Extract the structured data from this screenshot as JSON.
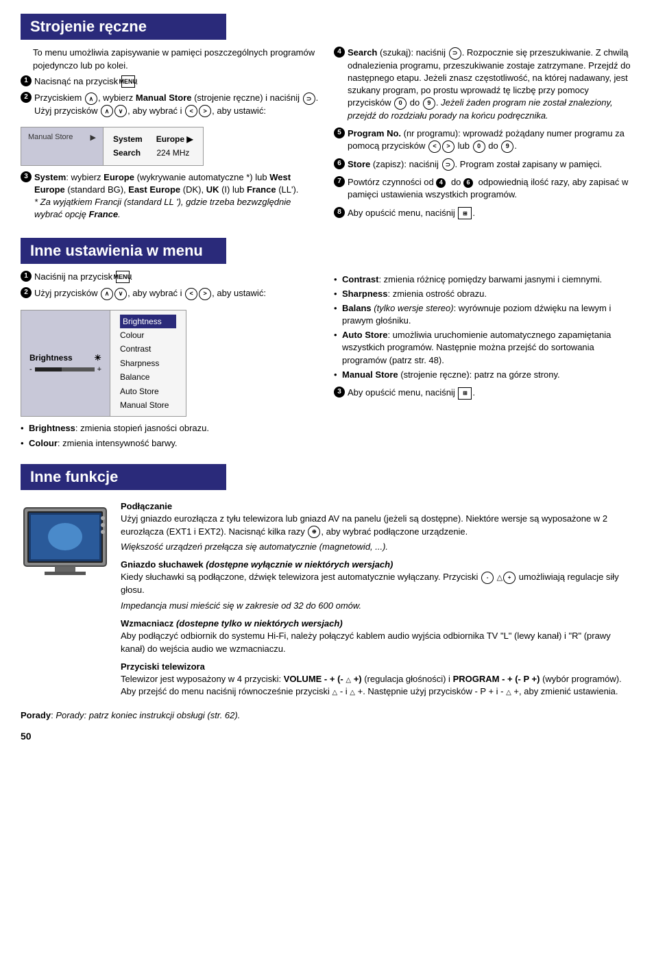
{
  "sections": {
    "strojenie": {
      "title": "Strojenie ręczne",
      "intro": "To menu umożliwia zapisywanie w pamięci poszczególnych programów pojedynczo lub po kolei.",
      "steps": [
        {
          "num": "1",
          "text": "Nacisnąć na przycisk"
        },
        {
          "num": "2",
          "text": "Przyciskiem , wybierz Manual Store (strojenie ręczne) i naciśnij . Użyj przycisków , aby wybrać i , aby ustawić:"
        },
        {
          "num": "3",
          "text": "System: wybierz Europe (wykrywanie automatyczne *) lub West Europe (standard BG), East Europe (DK), UK (I) lub France (LL').",
          "italic_note": "* Za wyjątkiem Francji (standard LL '), gdzie trzeba bezwzględnie wybrać opcję France."
        }
      ],
      "menu_left_title": "Manual Store",
      "menu_rows": [
        {
          "label": "System",
          "value": "Europe ▶"
        },
        {
          "label": "Search",
          "value": "224 MHz"
        }
      ],
      "right_steps": [
        {
          "num": "4",
          "bold_label": "Search",
          "bold_paren": "(szukaj)",
          "text": ": naciśnij . Rozpocznie się przeszukiwanie. Z chwilą odnalezienia programu, przeszukiwanie zostaje zatrzymane. Przejdź do następnego etapu. Jeżeli znasz częstotliwość, na której nadawany, jest szukany program, po prostu wprowadź tę liczbę przy pomocy przycisków",
          "end_text": ". Jeżeli żaden program nie został znaleziony, przejdź do rozdziału porady na końcu podręcznika.",
          "italic_end": true
        },
        {
          "num": "5",
          "bold_label": "Program No.",
          "paren": "(nr programu)",
          "text": ": wprowadź pożądany numer programu za pomocą przycisków lub do ."
        },
        {
          "num": "6",
          "bold_label": "Store",
          "paren": "(zapisz)",
          "text": ": naciśnij . Program został zapisany w pamięci."
        },
        {
          "num": "7",
          "text": "Powtórz czynności od do odpowiednią ilość razy, aby zapisać w pamięci ustawienia wszystkich programów."
        },
        {
          "num": "8",
          "text": "Aby opuścić menu, naciśnij"
        }
      ]
    },
    "inne_ustawienia": {
      "title": "Inne ustawienia w menu",
      "left_steps": [
        {
          "num": "1",
          "text": "Naciśnij na przycisk"
        },
        {
          "num": "2",
          "text": "Użyj przycisków , aby wybrać i , aby ustawić:"
        }
      ],
      "brightness_left_label": "Brightness",
      "brightness_bar_minus": "-",
      "brightness_bar_plus": "+",
      "brightness_menu_items": [
        "Brightness",
        "Colour",
        "Contrast",
        "Sharpness",
        "Balance",
        "Auto Store",
        "Manual Store"
      ],
      "right_bullets": [
        {
          "bold": "Contrast",
          "text": ": zmienia różnicę pomiędzy barwami jasnymi i ciemnymi."
        },
        {
          "bold": "Sharpness",
          "text": ": zmienia ostrość obrazu."
        },
        {
          "bold": "Balans",
          "italic": "(tylko wersje stereo)",
          "text": ": wyrównuje poziom dźwięku na lewym i prawym głośniku."
        },
        {
          "bold": "Auto Store",
          "text": ": umożliwia uruchomienie automatycznego zapamiętania wszystkich programów. Następnie można przejść do sortowania programów (patrz str. 48)."
        },
        {
          "bold": "Manual Store",
          "text": "(strojenie ręczne): patrz na górze strony."
        }
      ],
      "left_bullets": [
        {
          "bold": "Brightness",
          "text": ": zmienia stopień jasności obrazu."
        },
        {
          "bold": "Colour",
          "text": ": zmienia intensywność barwy."
        }
      ],
      "last_step": {
        "num": "3",
        "text": "Aby opuścić menu, naciśnij"
      }
    },
    "inne_funkcje": {
      "title": "Inne funkcje",
      "subsections": [
        {
          "title": "Podłączanie",
          "paragraphs": [
            "Użyj gniazdo eurozłącza z tyłu telewizora lub gniazd AV na panelu (jeżeli są dostępne). Niektóre wersje są wyposażone w 2 eurozłącza (EXT1 i EXT2). Nacisnąć kilka razy , aby wybrać podłączone urządzenie.",
            "Większość urządzeń przełącza się automatycznie (magnetowid, ...)."
          ],
          "italic_para": "Większość urządzeń przełącza się automatycznie (magnetowid, ...)."
        },
        {
          "title": "Gniazdo słuchawek",
          "title_italic": "(dostępne wyłącznie w niektórych wersjach)",
          "paragraphs": [
            "Kiedy słuchawki są podłączone, dźwięk telewizora jest automatycznie wyłączany. Przyciski umożliwiają regulacje siły głosu.",
            "Impedancja musi mieścić się w zakresie od 32 do 600 omów."
          ],
          "italic_para": "Impedancja musi mieścić się w zakresie od 32 do 600 omów."
        },
        {
          "title": "Wzmacniacz",
          "title_italic": "(dostepne tylko w niektórych wersjach)",
          "paragraphs": [
            "Aby podłączyć odbiornik do systemu Hi-Fi, należy połączyć kablem audio wyjścia odbiornika TV \"L\" (lewy kanał) i \"R\" (prawy kanał) do wejścia audio we wzmacniaczu."
          ]
        },
        {
          "title": "Przyciski telewizora",
          "paragraphs": [
            "Telewizor jest wyposażony w 4 przyciski: VOLUME - + (- + ) (regulacja głośności) i PROGRAM - + (- P +) (wybór programów). Aby przejść do menu naciśnij równocześnie przyciski  - i  +. Następnie użyj przycisków - P + i -  +, aby zmienić ustawienia."
          ]
        }
      ],
      "footer": "Porady: patrz koniec instrukcji obsługi (str. 62).",
      "page_num": "50"
    }
  }
}
